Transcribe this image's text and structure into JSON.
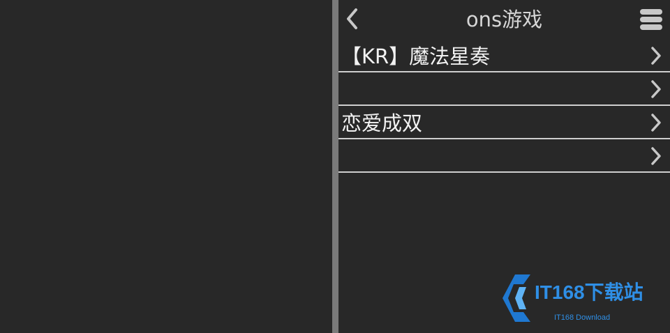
{
  "header": {
    "title": "ons游戏",
    "back_icon": "chevron-left-icon",
    "menu_icon": "hamburger-menu-icon"
  },
  "list": {
    "items": [
      {
        "label": "【KR】魔法星奏"
      },
      {
        "label": ""
      },
      {
        "label": "恋爱成双"
      },
      {
        "label": ""
      }
    ],
    "item_icon": "chevron-right-icon"
  },
  "watermark": {
    "brand": "IT168下载站",
    "sub": "IT168 Download"
  },
  "colors": {
    "background": "#282828",
    "divider": "#7a7a7a",
    "text": "#f2f2f2",
    "icon": "#c8c8c8",
    "watermark": "#2f8fe6"
  }
}
